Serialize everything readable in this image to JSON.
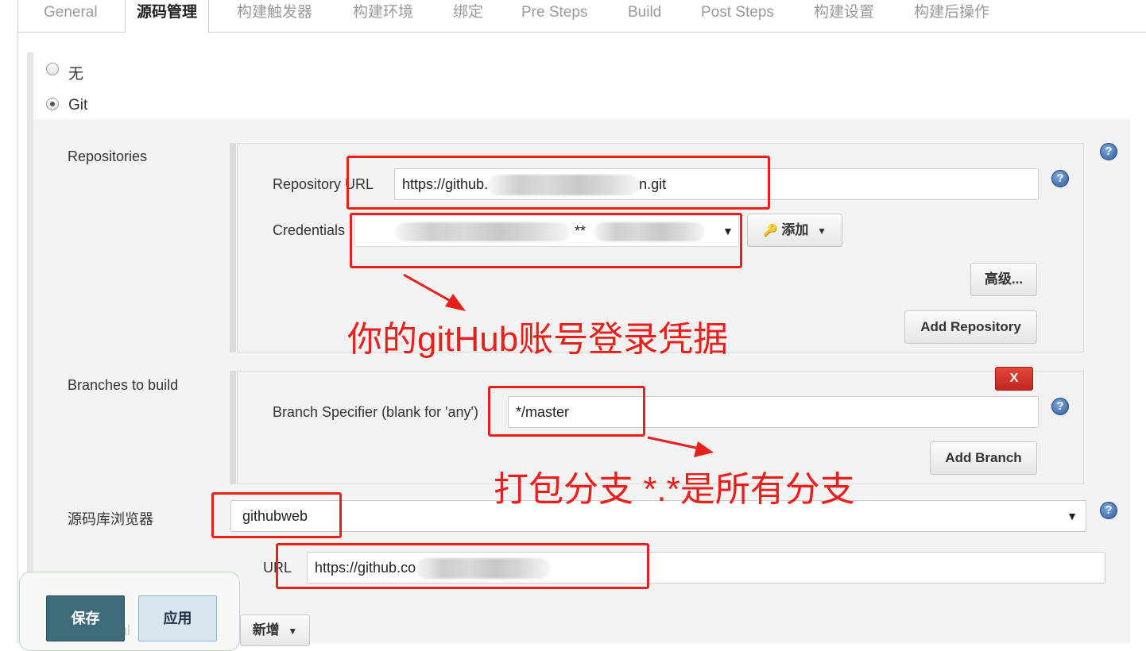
{
  "tabs": [
    {
      "label": "General"
    },
    {
      "label": "源码管理"
    },
    {
      "label": "构建触发器"
    },
    {
      "label": "构建环境"
    },
    {
      "label": "绑定"
    },
    {
      "label": "Pre Steps"
    },
    {
      "label": "Build"
    },
    {
      "label": "Post Steps"
    },
    {
      "label": "构建设置"
    },
    {
      "label": "构建后操作"
    }
  ],
  "scm": {
    "none_label": "无",
    "git_label": "Git",
    "selected": "Git"
  },
  "repositories": {
    "section_label": "Repositories",
    "url_label": "Repository URL",
    "url_prefix": "https://github.",
    "url_suffix": "n.git",
    "credentials_label": "Credentials",
    "credentials_visible": "**",
    "add_button": "添加",
    "advanced_button": "高级...",
    "add_repository_button": "Add Repository"
  },
  "branches": {
    "section_label": "Branches to build",
    "delete_button": "X",
    "specifier_label": "Branch Specifier (blank for 'any')",
    "specifier_value": "*/master",
    "add_branch_button": "Add Branch"
  },
  "browser": {
    "section_label": "源码库浏览器",
    "selected": "githubweb",
    "url_label": "URL",
    "url_value": "https://github.co"
  },
  "actions": {
    "save": "保存",
    "apply": "应用",
    "add_new": "新增",
    "hidden_label": "al"
  },
  "annotations": {
    "credentials_note": "你的gitHub账号登录凭据",
    "branch_note": "打包分支 *.*是所有分支"
  },
  "colors": {
    "annotation_red": "#e8201c",
    "save_button": "#3e6b7a",
    "help_blue": "#2d5da0"
  }
}
